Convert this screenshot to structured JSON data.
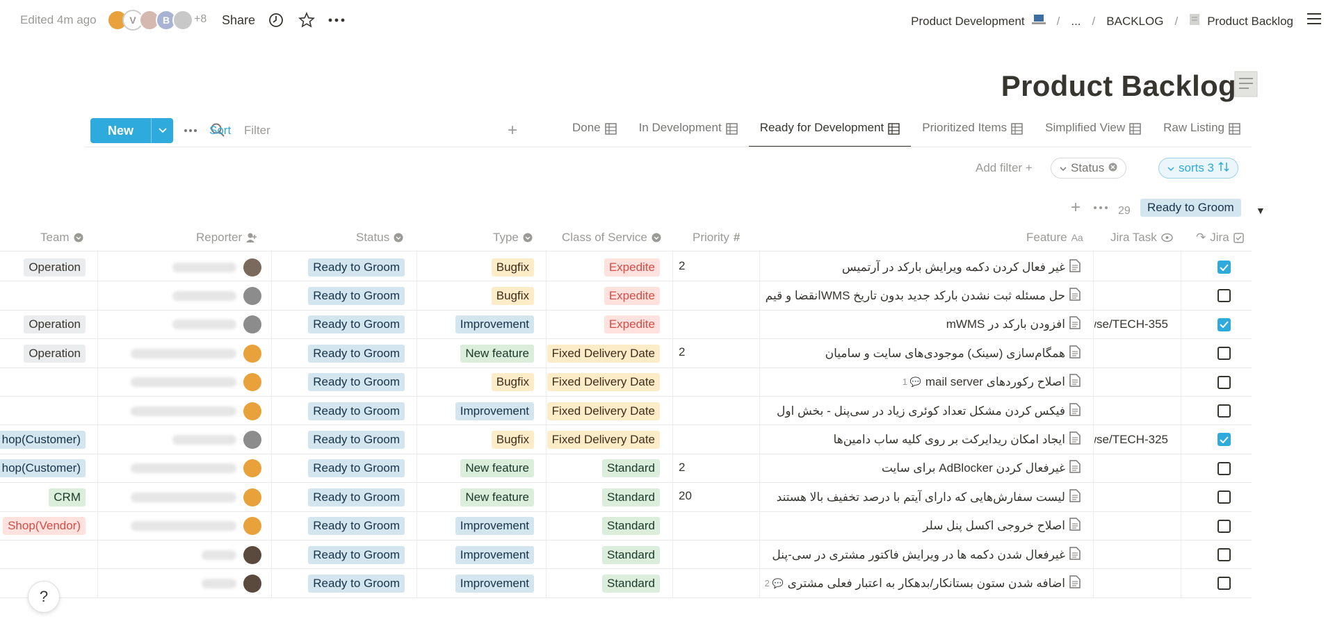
{
  "topbar": {
    "edited": "Edited 4m ago",
    "avatars_more": "+8",
    "share": "Share",
    "avatar_letters": [
      "V",
      "B"
    ],
    "breadcrumb": [
      "Product Development",
      "...",
      "BACKLOG",
      "Product Backlog"
    ]
  },
  "page": {
    "title": "Product Backlog"
  },
  "toolbar": {
    "new_label": "New",
    "sort_label": "Sort",
    "filter_label": "Filter",
    "views": [
      "Done",
      "In Development",
      "Ready for Development",
      "Prioritized Items",
      "Simplified View",
      "Raw Listing"
    ],
    "active_view": "Ready for Development"
  },
  "filters": {
    "add_filter": "Add filter",
    "status_pill": "Status",
    "sorts_pill": "sorts 3"
  },
  "group": {
    "count": "29",
    "name": "Ready to Groom"
  },
  "columns": {
    "team": "Team",
    "reporter": "Reporter",
    "status": "Status",
    "type": "Type",
    "cos": "Class of Service",
    "priority": "Priority",
    "feature": "Feature",
    "jira_task": "Jira Task",
    "jira": "Jira"
  },
  "rows": [
    {
      "team": "Operation",
      "status": "Ready to Groom",
      "type": "Bugfix",
      "cos": "Expedite",
      "priority": "2",
      "feature": "غیر فعال کردن دکمه ویرایش بارکد در آرتمیس",
      "jira_task": "",
      "jira": true
    },
    {
      "team": "",
      "status": "Ready to Groom",
      "type": "Bugfix",
      "cos": "Expedite",
      "priority": "",
      "feature": "حل مسئله ثبت نشدن بارکد جدید بدون تاریخ WMSانقضا و قیم",
      "jira_task": "",
      "jira": false
    },
    {
      "team": "Operation",
      "status": "Ready to Groom",
      "type": "Improvement",
      "cos": "Expedite",
      "priority": "",
      "feature": "افزودن بارکد در mWMS",
      "jira_task": "wse/TECH-355",
      "jira": true
    },
    {
      "team": "Operation",
      "status": "Ready to Groom",
      "type": "New feature",
      "cos": "Fixed Delivery Date",
      "priority": "2",
      "feature": "همگام‌سازی (سینک) موجودی‌های سایت و سامیان",
      "jira_task": "",
      "jira": false
    },
    {
      "team": "",
      "status": "Ready to Groom",
      "type": "Bugfix",
      "cos": "Fixed Delivery Date",
      "priority": "",
      "feature": "اصلاح رکوردهای mail server",
      "comments": "1",
      "jira_task": "",
      "jira": false
    },
    {
      "team": "",
      "status": "Ready to Groom",
      "type": "Improvement",
      "cos": "Fixed Delivery Date",
      "priority": "",
      "feature": "فیکس کردن مشکل تعداد کوئری زیاد در سی‌پنل - بخش اول",
      "jira_task": "",
      "jira": false
    },
    {
      "team": "hop(Customer)",
      "status": "Ready to Groom",
      "type": "Bugfix",
      "cos": "Fixed Delivery Date",
      "priority": "",
      "feature": "ایجاد امکان ریدایرکت بر روی کلیه ساب دامین‌ها",
      "jira_task": "wse/TECH-325",
      "jira": true
    },
    {
      "team": "hop(Customer)",
      "status": "Ready to Groom",
      "type": "New feature",
      "cos": "Standard",
      "priority": "2",
      "feature": "غیرفعال کردن AdBlocker برای سایت",
      "jira_task": "",
      "jira": false
    },
    {
      "team": "CRM",
      "status": "Ready to Groom",
      "type": "New feature",
      "cos": "Standard",
      "priority": "20",
      "feature": "لیست سفارش‌هایی که دارای آیتم با درصد تخفیف بالا هستند",
      "jira_task": "",
      "jira": false
    },
    {
      "team": "Shop(Vendor)",
      "status": "Ready to Groom",
      "type": "Improvement",
      "cos": "Standard",
      "priority": "",
      "feature": "اصلاح خروجی اکسل پنل سلر",
      "jira_task": "",
      "jira": false
    },
    {
      "team": "",
      "status": "Ready to Groom",
      "type": "Improvement",
      "cos": "Standard",
      "priority": "",
      "feature": "غیرفعال شدن دکمه ها در ویرایش فاکتور مشتری در سی-پنل",
      "jira_task": "",
      "jira": false
    },
    {
      "team": "",
      "status": "Ready to Groom",
      "type": "Improvement",
      "cos": "Standard",
      "priority": "",
      "feature": "اضافه شدن ستون بستانکار/بدهکار به اعتبار فعلی مشتری",
      "comments": "2",
      "jira_task": "",
      "jira": false
    }
  ],
  "help": "?",
  "colors": {
    "accent": "#2eaadc",
    "status_blue": "#d3e5ef",
    "tag_green": "#dbeddb",
    "tag_yellow": "#fdecc8",
    "tag_red": "#ffe2dd"
  }
}
